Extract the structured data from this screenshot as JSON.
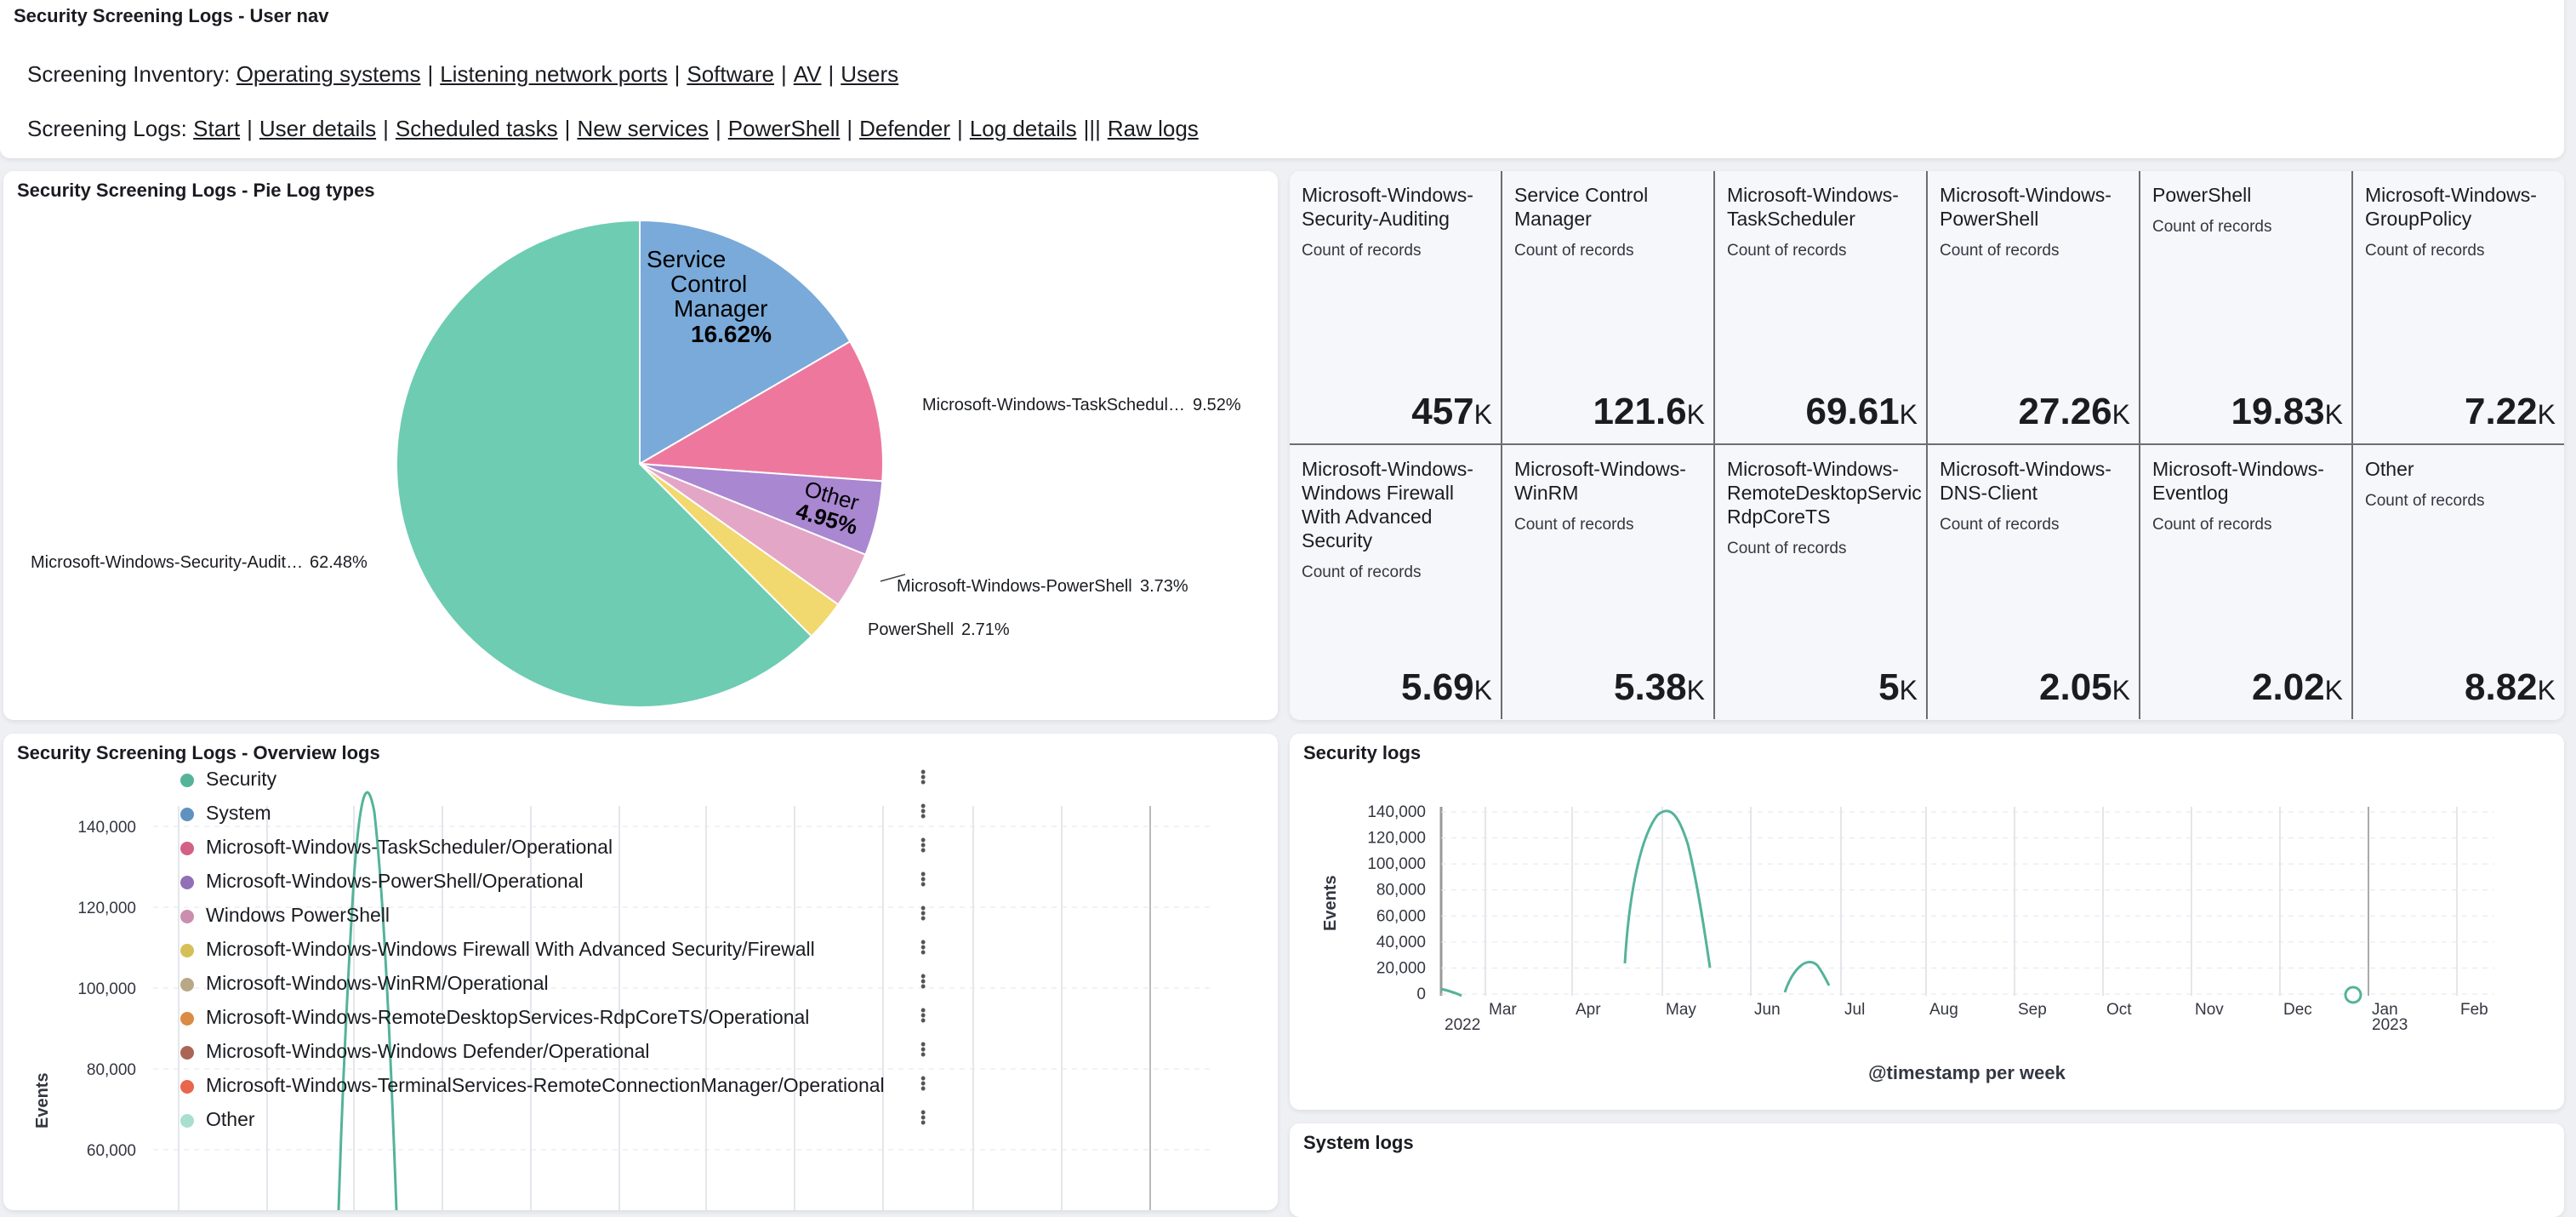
{
  "nav_panel": {
    "title": "Security Screening Logs - User nav",
    "inventory_label": "Screening Inventory:",
    "inventory_links": [
      "Operating systems",
      "Listening network ports",
      "Software",
      "AV",
      "Users"
    ],
    "logs_label": "Screening Logs:",
    "logs_links": [
      "Start",
      "User details",
      "Scheduled tasks",
      "New services",
      "PowerShell",
      "Defender",
      "Log details"
    ],
    "logs_sep_extra": "|||",
    "raw_logs_link": "Raw logs"
  },
  "pie_panel": {
    "title": "Security Screening Logs - Pie Log types",
    "inner_label_scm": [
      "Service",
      "Control",
      "Manager"
    ],
    "inner_pct_scm": "16.62%",
    "inner_label_other": "Other",
    "inner_pct_other": "4.95%",
    "outer_labels": [
      {
        "text": "Microsoft-Windows-TaskSchedul…",
        "pct": "9.52%"
      },
      {
        "text": "Microsoft-Windows-PowerShell",
        "pct": "3.73%"
      },
      {
        "text": "PowerShell",
        "pct": "2.71%"
      },
      {
        "text": "Microsoft-Windows-Security-Audit…",
        "pct": "62.48%"
      }
    ]
  },
  "chart_data": [
    {
      "type": "pie",
      "title": "Security Screening Logs - Pie Log types",
      "slices": [
        {
          "label": "Service Control Manager",
          "value": 16.62,
          "color": "#79aad9"
        },
        {
          "label": "Microsoft-Windows-TaskScheduler",
          "value": 9.52,
          "color": "#ee789d"
        },
        {
          "label": "Other",
          "value": 4.95,
          "color": "#a987d1"
        },
        {
          "label": "Microsoft-Windows-PowerShell",
          "value": 3.73,
          "color": "#e4a6c7"
        },
        {
          "label": "PowerShell",
          "value": 2.71,
          "color": "#f1d86f"
        },
        {
          "label": "Microsoft-Windows-Security-Auditing",
          "value": 62.48,
          "color": "#6dccb1"
        }
      ]
    },
    {
      "type": "line",
      "title": "Security Screening Logs - Overview logs",
      "ylabel": "Events",
      "yticks": [
        "140,000",
        "120,000",
        "100,000",
        "80,000",
        "60,000"
      ],
      "ylim": [
        50000,
        145000
      ],
      "series": [
        {
          "name": "Security",
          "color": "#54b399"
        }
      ]
    },
    {
      "type": "line",
      "title": "Security logs",
      "xlabel": "@timestamp per week",
      "ylabel": "Events",
      "yticks": [
        "140,000",
        "120,000",
        "100,000",
        "80,000",
        "60,000",
        "40,000",
        "20,000",
        "0"
      ],
      "xticks": [
        "Mar",
        "Apr",
        "May",
        "Jun",
        "Jul",
        "Aug",
        "Sep",
        "Oct",
        "Nov",
        "Dec",
        "Jan",
        "Feb"
      ],
      "xyears": [
        "2022",
        "2023"
      ],
      "ylim": [
        0,
        145000
      ],
      "series": [
        {
          "name": "Security",
          "color": "#54b399"
        }
      ]
    }
  ],
  "metrics": [
    {
      "title": "Microsoft-Windows-\nSecurity-Auditing",
      "sub": "Count of records",
      "value": "457",
      "unit": "K"
    },
    {
      "title": "Service Control\nManager",
      "sub": "Count of records",
      "value": "121.6",
      "unit": "K"
    },
    {
      "title": "Microsoft-Windows-\nTaskScheduler",
      "sub": "Count of records",
      "value": "69.61",
      "unit": "K"
    },
    {
      "title": "Microsoft-Windows-\nPowerShell",
      "sub": "Count of records",
      "value": "27.26",
      "unit": "K"
    },
    {
      "title": "PowerShell",
      "sub": "Count of records",
      "value": "19.83",
      "unit": "K"
    },
    {
      "title": "Microsoft-Windows-\nGroupPolicy",
      "sub": "Count of records",
      "value": "7.22",
      "unit": "K"
    },
    {
      "title": "Microsoft-Windows-\nWindows Firewall\nWith Advanced\nSecurity",
      "sub": "Count of records",
      "value": "5.69",
      "unit": "K"
    },
    {
      "title": "Microsoft-Windows-\nWinRM",
      "sub": "Count of records",
      "value": "5.38",
      "unit": "K"
    },
    {
      "title": "Microsoft-Windows-\nRemoteDesktopServic\nRdpCoreTS",
      "sub": "Count of records",
      "value": "5",
      "unit": "K"
    },
    {
      "title": "Microsoft-Windows-\nDNS-Client",
      "sub": "Count of records",
      "value": "2.05",
      "unit": "K"
    },
    {
      "title": "Microsoft-Windows-\nEventlog",
      "sub": "Count of records",
      "value": "2.02",
      "unit": "K"
    },
    {
      "title": "Other",
      "sub": "Count of records",
      "value": "8.82",
      "unit": "K"
    }
  ],
  "overview_panel": {
    "title": "Security Screening Logs - Overview logs",
    "ylabel": "Events",
    "legend": [
      {
        "label": "Security",
        "color": "#54b399"
      },
      {
        "label": "System",
        "color": "#6092c0"
      },
      {
        "label": "Microsoft-Windows-TaskScheduler/Operational",
        "color": "#d36086"
      },
      {
        "label": "Microsoft-Windows-PowerShell/Operational",
        "color": "#9170b8"
      },
      {
        "label": "Windows PowerShell",
        "color": "#ca8eae"
      },
      {
        "label": "Microsoft-Windows-Windows Firewall With Advanced Security/Firewall",
        "color": "#d6bf57"
      },
      {
        "label": "Microsoft-Windows-WinRM/Operational",
        "color": "#b9a888"
      },
      {
        "label": "Microsoft-Windows-RemoteDesktopServices-RdpCoreTS/Operational",
        "color": "#da8b45"
      },
      {
        "label": "Microsoft-Windows-Windows Defender/Operational",
        "color": "#aa6556"
      },
      {
        "label": "Microsoft-Windows-TerminalServices-RemoteConnectionManager/Operational",
        "color": "#e7664c"
      },
      {
        "label": "Other",
        "color": "#a8dfce"
      }
    ]
  },
  "security_panel": {
    "title": "Security logs"
  },
  "system_panel": {
    "title": "System logs"
  }
}
